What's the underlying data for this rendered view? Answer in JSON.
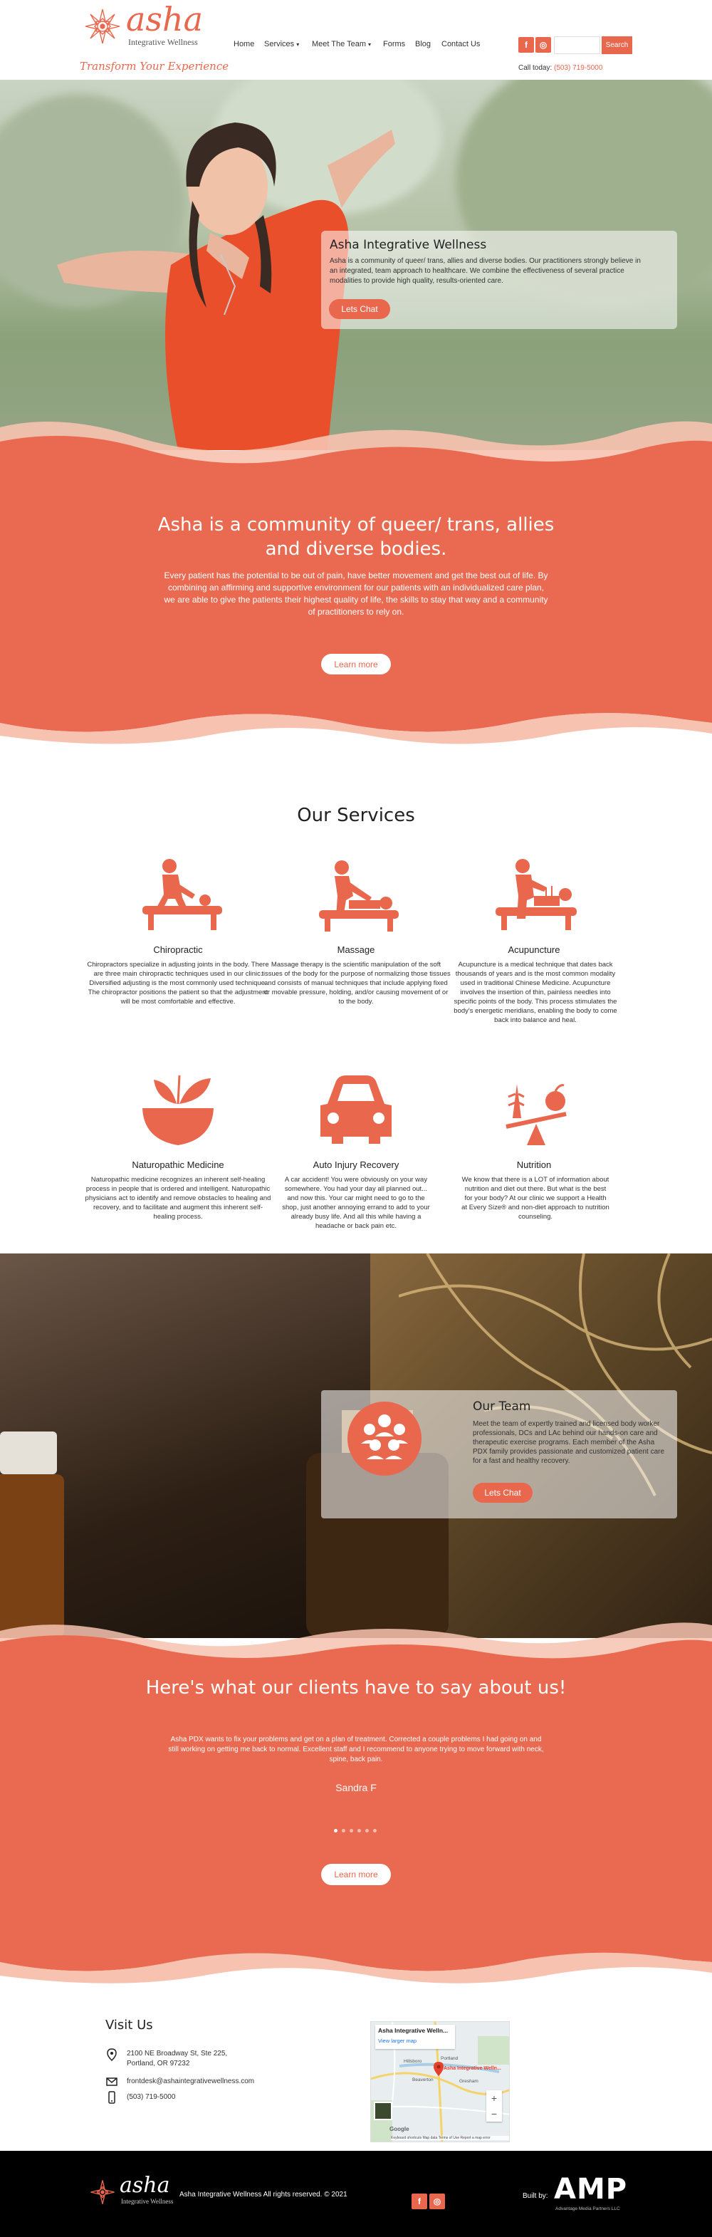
{
  "brand": {
    "logo_word": "asha",
    "logo_sub": "Integrative Wellness",
    "tagline": "Transform Your Experience",
    "accent": "#e8674d"
  },
  "nav": {
    "items": [
      "Home",
      "Services",
      "Meet The Team",
      "Forms",
      "Blog",
      "Contact Us"
    ],
    "search_button": "Search",
    "call_label": "Call today:",
    "call_number": "(503) 719-5000",
    "social": [
      "facebook-icon",
      "instagram-icon"
    ]
  },
  "hero": {
    "title": "Asha Integrative Wellness",
    "text": "Asha is a community of queer/ trans, allies and diverse bodies. Our practitioners strongly believe in an integrated, team approach to healthcare. We combine the effectiveness of several practice modalities to provide high quality, results-oriented care.",
    "button": "Lets Chat"
  },
  "community": {
    "heading": "Asha is a community of queer/ trans, allies and diverse bodies.",
    "text": "Every patient has the potential to be out of pain, have better movement and get the best out of life. By combining an affirming and supportive environment for our patients with an individualized care plan, we are able to give the patients their highest quality of life, the skills to stay that way and a community of practitioners to rely on.",
    "button": "Learn more"
  },
  "services": {
    "title": "Our Services",
    "items": [
      {
        "name": "Chiropractic",
        "icon": "chiropractic-icon",
        "desc": "Chiropractors specialize in adjusting joints in the body. There are three main chiropractic techniques used in our clinic. Diversified adjusting is the most commonly used technique. The chiropractor positions the patient so that the adjustment will be most comfortable and effective."
      },
      {
        "name": "Massage",
        "icon": "massage-icon",
        "desc": "Massage therapy is the scientific manipulation of the soft tissues of the body for the purpose of normalizing those tissues and consists of manual techniques that include applying fixed or movable pressure, holding, and/or causing movement of or to the body."
      },
      {
        "name": "Acupuncture",
        "icon": "acupuncture-icon",
        "desc": "Acupuncture is a medical technique that dates back thousands of years and is the most common modality used in traditional Chinese Medicine. Acupuncture involves the insertion of thin, painless needles into specific points of the body. This process stimulates the body's energetic meridians, enabling the body to come back into balance and heal."
      },
      {
        "name": "Naturopathic Medicine",
        "icon": "mortar-leaves-icon",
        "desc": "Naturopathic medicine recognizes an inherent self-healing process in people that is ordered and intelligent. Naturopathic physicians act to identify and remove obstacles to healing and recovery, and to facilitate and augment this inherent self-healing process."
      },
      {
        "name": "Auto Injury Recovery",
        "icon": "car-icon",
        "desc": "A car accident! You were obviously on your way somewhere. You had your day all planned out... and now this. Your car might need to go to the shop, just another annoying errand to add to your already busy life. And all this while having a headache or back pain etc."
      },
      {
        "name": "Nutrition",
        "icon": "nutrition-scale-icon",
        "desc": "We know that there is a LOT of information about nutrition and diet out there. But what is the best for your body? At our clinic we support a Health at Every Size® and non-diet approach to nutrition counseling."
      }
    ]
  },
  "team": {
    "title": "Our Team",
    "text": "Meet the team of expertly trained and licensed body worker professionals, DCs and LAc behind our hands-on care and therapeutic exercise programs. Each member of the Asha PDX family provides passionate and customized patient care for a fast and healthy recovery.",
    "button": "Lets Chat",
    "icon": "team-people-icon"
  },
  "testimonials": {
    "heading": "Here's what our clients have to say about us!",
    "quote": "Asha PDX wants to fix your problems and get on a plan of treatment. Corrected a couple problems I had going on and still working on getting me back to normal. Excellent staff and I recommend to anyone trying to move forward with neck, spine, back pain.",
    "author": "Sandra F",
    "slides": 6,
    "active_slide": 0,
    "button": "Learn more"
  },
  "visit": {
    "title": "Visit Us",
    "address1": "2100 NE Broadway St, Ste 225,",
    "address2": "Portland, OR 97232",
    "email": "frontdesk@ashaintegrativewellness.com",
    "phone": "(503) 719-5000",
    "map": {
      "place": "Asha Integrative Welln...",
      "link": "View larger map",
      "pin_label": "Asha Integrative Welln...",
      "towns": [
        "Hillsboro",
        "Portland",
        "Beaverton",
        "Gresham"
      ],
      "attribution": [
        "Keyboard shortcuts",
        "Map data",
        "Terms of Use",
        "Report a map error"
      ],
      "brand": "Google"
    }
  },
  "footer": {
    "logo_word": "asha",
    "logo_sub": "Integrative Wellness",
    "copyright": "Asha Integrative Wellness All rights reserved. © 2021",
    "built_by": "Built by:",
    "amp": "AMP",
    "amp_sub": "Advantage Media Partners LLC"
  }
}
